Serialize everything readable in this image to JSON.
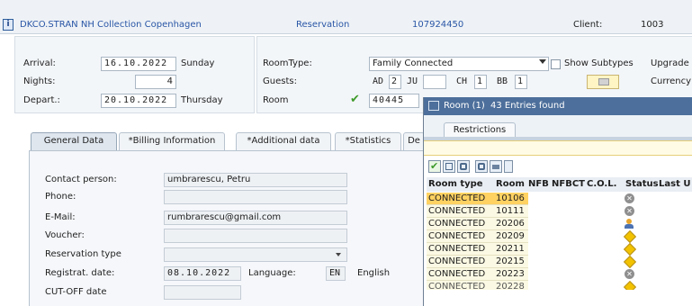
{
  "header": {
    "hotel": "DKCO.STRAN NH Collection Copenhagen",
    "reservation_label": "Reservation",
    "reservation_no": "107924450",
    "client_label": "Client:",
    "client_no": "1003"
  },
  "stay": {
    "arrival_label": "Arrival:",
    "arrival_date": "16.10.2022",
    "arrival_day": "Sunday",
    "nights_label": "Nights:",
    "nights": "4",
    "departure_label": "Depart.:",
    "departure_date": "20.10.2022",
    "departure_day": "Thursday"
  },
  "room": {
    "roomtype_label": "RoomType:",
    "roomtype_value": "Family Connected",
    "show_subtypes": "Show Subtypes",
    "guests_label": "Guests:",
    "ad_label": "AD",
    "ad_value": "2",
    "ju_label": "JU",
    "ju_value": "",
    "ch_label": "CH",
    "ch_value": "1",
    "bb_label": "BB",
    "bb_value": "1",
    "room_label": "Room",
    "room_value": "40445",
    "upgrade_label": "Upgrade",
    "currency_label": "Currency"
  },
  "tabs": [
    "General Data",
    "*Billing Information",
    "*Additional data",
    "*Statistics",
    "De"
  ],
  "general": {
    "contact_label": "Contact person:",
    "contact_value": "umbrarescu, Petru",
    "phone_label": "Phone:",
    "phone_value": "",
    "email_label": "E-Mail:",
    "email_value": "rumbrarescu@gmail.com",
    "voucher_label": "Voucher:",
    "voucher_value": "",
    "restype_label": "Reservation type",
    "restype_value": "",
    "regdate_label": "Registrat. date:",
    "regdate_value": "08.10.2022",
    "language_label": "Language:",
    "language_code": "EN",
    "language_name": "English",
    "cutoff_label": "CUT-OFF date",
    "cutoff_value": ""
  },
  "popup": {
    "title": "Room (1)",
    "found": "43 Entries found",
    "restrictions_tab": "Restrictions",
    "columns": [
      "Room type",
      "Room",
      "NFB",
      "NFBCT",
      "C.O.L.",
      "Status",
      "Last U"
    ],
    "rows": [
      {
        "type": "CONNECTED",
        "room": "10106",
        "status": "x",
        "selected": true
      },
      {
        "type": "CONNECTED",
        "room": "10111",
        "status": "x",
        "selected": false
      },
      {
        "type": "CONNECTED",
        "room": "20206",
        "status": "person",
        "selected": false
      },
      {
        "type": "CONNECTED",
        "room": "20209",
        "status": "diamond",
        "selected": false
      },
      {
        "type": "CONNECTED",
        "room": "20211",
        "status": "diamond",
        "selected": false
      },
      {
        "type": "CONNECTED",
        "room": "20215",
        "status": "diamond",
        "selected": false
      },
      {
        "type": "CONNECTED",
        "room": "20223",
        "status": "x",
        "selected": false
      },
      {
        "type": "CONNECTED",
        "room": "20228",
        "status": "diamond",
        "selected": false
      }
    ]
  }
}
